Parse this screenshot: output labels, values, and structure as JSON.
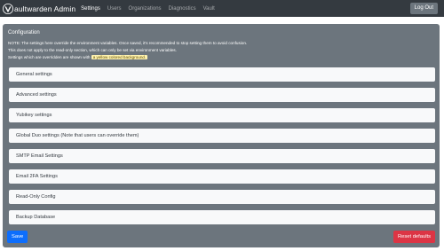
{
  "navbar": {
    "brand": "aultwarden Admin",
    "logo_icon": "vaultwarden-logo-icon",
    "links": [
      {
        "label": "Settings",
        "active": true
      },
      {
        "label": "Users",
        "active": false
      },
      {
        "label": "Organizations",
        "active": false
      },
      {
        "label": "Diagnostics",
        "active": false
      },
      {
        "label": "Vault",
        "active": false
      }
    ],
    "logout_label": "Log Out"
  },
  "config": {
    "title": "Configuration",
    "note_line1": "NOTE: The settings here override the environment variables. Once saved, it's recommended to stop setting them to avoid confusion.",
    "note_line2": "This does not apply to the read-only section, which can only be set via environment variables.",
    "note_line3_prefix": "Settings which are overridden are shown with",
    "note_highlight": "a yellow colored background.",
    "sections": [
      "General settings",
      "Advanced settings",
      "Yubikey settings",
      "Global Duo settings (Note that users can override them)",
      "SMTP Email Settings",
      "Email 2FA Settings",
      "Read-Only Config",
      "Backup Database"
    ],
    "save_label": "Save",
    "reset_label": "Reset defaults"
  },
  "colors": {
    "navbar": "#343a40",
    "panel": "#6c757d",
    "save": "#0d6efd",
    "reset": "#dc3545",
    "highlight": "#fff3b0"
  }
}
